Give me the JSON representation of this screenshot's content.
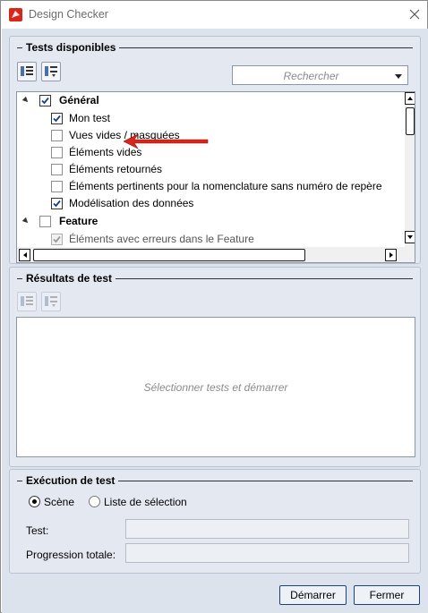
{
  "window": {
    "title": "Design Checker"
  },
  "icons": {
    "app": "app-icon",
    "close": "close-icon",
    "toolbar_expand": "expand-all-icon",
    "toolbar_collapse": "collapse-all-icon",
    "annotation": "red-arrow-icon"
  },
  "colors": {
    "annotation_arrow": "#d9261c",
    "panel_background": "#dde3ec",
    "button_border": "#1f3f80"
  },
  "tests_group": {
    "title": "Tests disponibles",
    "search_placeholder": "Rechercher",
    "tree": [
      {
        "label": "Général",
        "level": 0,
        "checked": true,
        "bold": true,
        "expanded": true
      },
      {
        "label": "Mon test",
        "level": 1,
        "checked": true
      },
      {
        "label": "Vues vides / masquées",
        "level": 1,
        "checked": false
      },
      {
        "label": "Éléments vides",
        "level": 1,
        "checked": false
      },
      {
        "label": "Éléments retournés",
        "level": 1,
        "checked": false
      },
      {
        "label": "Éléments pertinents pour la nomenclature sans numéro de repère",
        "level": 1,
        "checked": false
      },
      {
        "label": "Modélisation des données",
        "level": 1,
        "checked": true
      },
      {
        "label": "Feature",
        "level": 0,
        "checked": false,
        "bold": true,
        "expanded": true
      },
      {
        "label": "Éléments avec erreurs dans le Feature",
        "level": 1,
        "checked": true,
        "disabled": true
      }
    ]
  },
  "results_group": {
    "title": "Résultats de test",
    "placeholder": "Sélectionner tests et démarrer"
  },
  "execution_group": {
    "title": "Exécution de test",
    "radio_options": [
      {
        "label": "Scène",
        "selected": true
      },
      {
        "label": "Liste de sélection",
        "selected": false
      }
    ],
    "test_label": "Test:",
    "test_value": "",
    "progress_label": "Progression totale:",
    "progress_value": ""
  },
  "footer": {
    "start_label": "Démarrer",
    "close_label": "Fermer"
  }
}
